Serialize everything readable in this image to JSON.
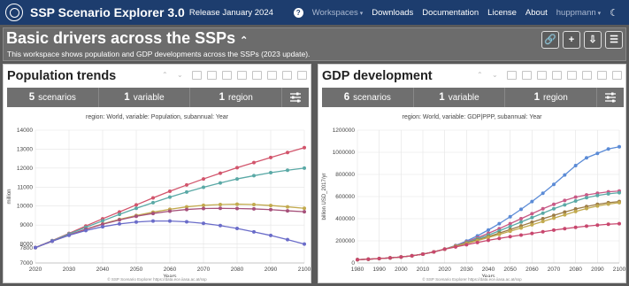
{
  "topbar": {
    "app_title": "SSP Scenario Explorer 3.0",
    "release": "Release January 2024",
    "nav": [
      "Workspaces",
      "Downloads",
      "Documentation",
      "License",
      "About",
      "huppmann"
    ]
  },
  "workspace": {
    "title": "Basic drivers across the SSPs",
    "description": "This workspace shows population and GDP developments across the SSPs (2023 update)."
  },
  "panels": [
    {
      "title": "Population trends",
      "filters": [
        {
          "count": "5",
          "label": "scenarios"
        },
        {
          "count": "1",
          "label": "variable"
        },
        {
          "count": "1",
          "label": "region"
        }
      ],
      "subtitle": "region: World, variable: Population, subannual: Year",
      "footer": "© SSP Scenario Explorer https://data.ece.iiasa.ac.at/ssp"
    },
    {
      "title": "GDP development",
      "filters": [
        {
          "count": "6",
          "label": "scenarios"
        },
        {
          "count": "1",
          "label": "variable"
        },
        {
          "count": "1",
          "label": "region"
        }
      ],
      "subtitle": "region: World, variable: GDP|PPP, subannual: Year",
      "footer": "© SSP Scenario Explorer https://data.ece.iiasa.ac.at/ssp"
    }
  ],
  "chart_data": [
    {
      "type": "line",
      "xlabel": "Years",
      "ylabel": "million",
      "xlim": [
        2020,
        2100
      ],
      "ylim": [
        7000,
        14000
      ],
      "xticks": [
        2020,
        2030,
        2040,
        2050,
        2060,
        2070,
        2080,
        2090,
        2100
      ],
      "yticks": [
        7000,
        7800,
        8000,
        9000,
        10000,
        11000,
        12000,
        13000,
        14000
      ],
      "grid": true,
      "x": [
        2020,
        2025,
        2030,
        2035,
        2040,
        2045,
        2050,
        2055,
        2060,
        2065,
        2070,
        2075,
        2080,
        2085,
        2090,
        2095,
        2100
      ],
      "series": [
        {
          "color": "#d2556c",
          "values": [
            7810,
            8180,
            8560,
            8950,
            9330,
            9690,
            10060,
            10430,
            10780,
            11110,
            11430,
            11730,
            12020,
            12290,
            12560,
            12820,
            13080
          ]
        },
        {
          "color": "#5aa9a6",
          "values": [
            7810,
            8170,
            8530,
            8880,
            9220,
            9560,
            9880,
            10180,
            10470,
            10740,
            10990,
            11220,
            11430,
            11600,
            11760,
            11890,
            12000
          ]
        },
        {
          "color": "#c2aa4e",
          "values": [
            7810,
            8150,
            8470,
            8780,
            9060,
            9300,
            9500,
            9680,
            9830,
            9960,
            10040,
            10080,
            10100,
            10080,
            10030,
            9960,
            9880
          ]
        },
        {
          "color": "#a6507a",
          "values": [
            7810,
            8150,
            8470,
            8780,
            9040,
            9270,
            9460,
            9610,
            9730,
            9820,
            9870,
            9880,
            9870,
            9850,
            9810,
            9750,
            9700
          ]
        },
        {
          "color": "#6a6cc9",
          "values": [
            7810,
            8150,
            8460,
            8710,
            8910,
            9060,
            9160,
            9210,
            9210,
            9170,
            9090,
            8970,
            8820,
            8640,
            8450,
            8230,
            8000
          ]
        }
      ]
    },
    {
      "type": "line",
      "xlabel": "Years",
      "ylabel": "billion USD_2017/yr",
      "xlim": [
        1980,
        2100
      ],
      "ylim": [
        0,
        1200000
      ],
      "xticks": [
        1980,
        1990,
        2000,
        2010,
        2020,
        2030,
        2040,
        2050,
        2060,
        2070,
        2080,
        2090,
        2100
      ],
      "yticks": [
        0,
        200000,
        400000,
        600000,
        800000,
        1000000,
        1200000
      ],
      "grid": true,
      "x": [
        1980,
        1985,
        1990,
        1995,
        2000,
        2005,
        2010,
        2015,
        2020,
        2025,
        2030,
        2035,
        2040,
        2045,
        2050,
        2055,
        2060,
        2065,
        2070,
        2075,
        2080,
        2085,
        2090,
        2095,
        2100
      ],
      "series": [
        {
          "color": "#5b8bd6",
          "values": [
            30000,
            34000,
            40000,
            46000,
            54000,
            65000,
            80000,
            100000,
            125000,
            158000,
            198000,
            245000,
            298000,
            355000,
            418000,
            485000,
            555000,
            630000,
            710000,
            795000,
            880000,
            950000,
            990000,
            1030000,
            1050000
          ]
        },
        {
          "color": "#c85a86",
          "values": [
            30000,
            34000,
            40000,
            46000,
            54000,
            65000,
            80000,
            100000,
            125000,
            156000,
            190000,
            228000,
            268000,
            310000,
            355000,
            400000,
            445000,
            490000,
            530000,
            565000,
            595000,
            615000,
            630000,
            643000,
            650000
          ]
        },
        {
          "color": "#5aa9a6",
          "values": [
            30000,
            34000,
            40000,
            46000,
            54000,
            65000,
            80000,
            100000,
            125000,
            154000,
            185000,
            218000,
            252000,
            290000,
            330000,
            370000,
            410000,
            450000,
            490000,
            525000,
            560000,
            590000,
            610000,
            625000,
            635000
          ]
        },
        {
          "color": "#9b7b45",
          "values": [
            30000,
            34000,
            40000,
            46000,
            54000,
            65000,
            80000,
            100000,
            125000,
            152000,
            180000,
            208000,
            238000,
            270000,
            302000,
            335000,
            368000,
            400000,
            430000,
            460000,
            488000,
            510000,
            530000,
            545000,
            555000
          ]
        },
        {
          "color": "#c2aa4e",
          "values": [
            30000,
            34000,
            40000,
            46000,
            54000,
            65000,
            80000,
            100000,
            125000,
            150000,
            176000,
            202000,
            230000,
            258000,
            287000,
            316000,
            345000,
            375000,
            405000,
            435000,
            465000,
            492000,
            515000,
            532000,
            545000
          ]
        },
        {
          "color": "#c8476e",
          "values": [
            30000,
            34000,
            40000,
            46000,
            54000,
            65000,
            80000,
            100000,
            125000,
            145000,
            165000,
            185000,
            205000,
            222000,
            238000,
            252000,
            267000,
            282000,
            297000,
            310000,
            322000,
            333000,
            342000,
            350000,
            355000
          ]
        }
      ]
    }
  ]
}
